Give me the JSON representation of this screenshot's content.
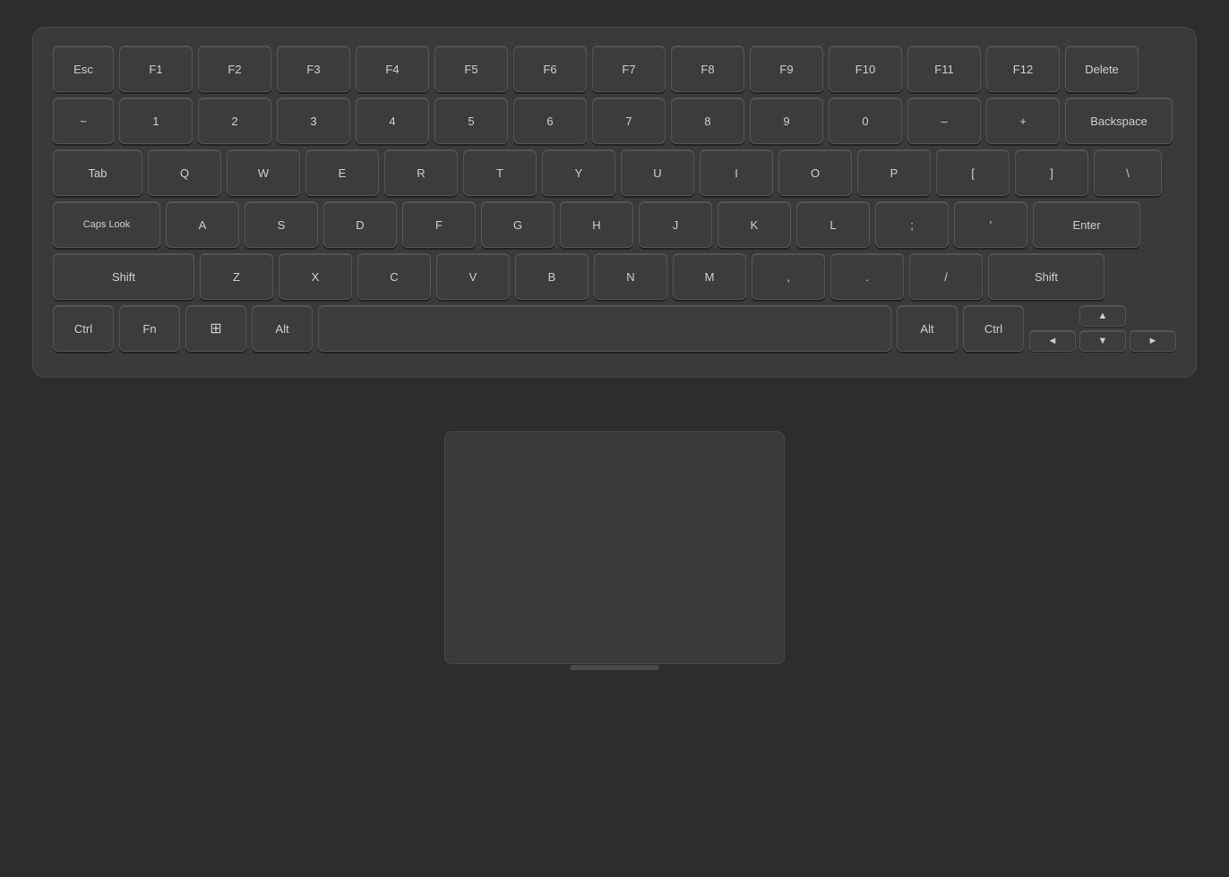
{
  "keyboard": {
    "row1": {
      "keys": [
        "Esc",
        "F1",
        "F2",
        "F3",
        "F4",
        "F5",
        "F6",
        "F7",
        "F8",
        "F9",
        "F10",
        "F11",
        "F12",
        "Delete"
      ]
    },
    "row2": {
      "keys": [
        "~",
        "1",
        "2",
        "3",
        "4",
        "5",
        "6",
        "7",
        "8",
        "9",
        "0",
        "–",
        "+",
        "Backspace"
      ]
    },
    "row3": {
      "keys": [
        "Tab",
        "Q",
        "W",
        "E",
        "R",
        "T",
        "Y",
        "U",
        "I",
        "O",
        "P",
        "[",
        "]",
        "\\"
      ]
    },
    "row4": {
      "keys": [
        "Caps Look",
        "A",
        "S",
        "D",
        "F",
        "G",
        "H",
        "J",
        "K",
        "L",
        ";",
        "'",
        "Enter"
      ]
    },
    "row5": {
      "keys": [
        "Shift",
        "Z",
        "X",
        "C",
        "V",
        "B",
        "N",
        "M",
        ",",
        ".",
        "/ ",
        "Shift"
      ]
    },
    "row6": {
      "keys": [
        "Ctrl",
        "Fn",
        "Win",
        "Alt",
        "",
        "Alt",
        "Ctrl"
      ]
    },
    "arrows": {
      "up": "▲",
      "left": "◄",
      "down": "▼",
      "right": "►"
    }
  }
}
